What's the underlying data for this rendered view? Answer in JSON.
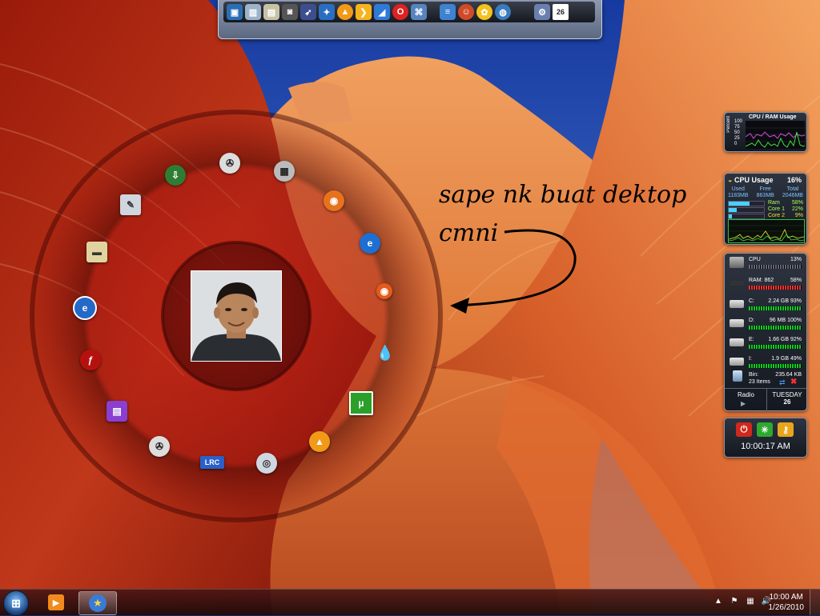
{
  "dock": {
    "icons": [
      "desktop-icon",
      "recycle-bin-icon",
      "folder-icon",
      "camera-icon",
      "rocket-icon",
      "winamp-icon",
      "aimp-icon",
      "logo-icon",
      "opera-icon",
      "app-icon",
      "notepad-icon",
      "smiley-icon",
      "messenger-icon",
      "globe-icon",
      "gear-icon"
    ],
    "calendar_day": "26"
  },
  "annotation": {
    "line1": "sape nk buat dektop",
    "line2": "cmni"
  },
  "cpu_ram_graph": {
    "title": "CPU / RAM Usage",
    "y_label": "Percent",
    "ticks": [
      "100",
      "75",
      "50",
      "25",
      "0"
    ]
  },
  "cpu_usage_gadget": {
    "title": "CPU Usage",
    "percent": "16%",
    "columns": [
      {
        "label": "Used",
        "value": "1183MB"
      },
      {
        "label": "Free",
        "value": "863MB"
      },
      {
        "label": "Total",
        "value": "2046MB"
      }
    ],
    "rows": [
      {
        "label": "Ram",
        "value": "58%",
        "fill": 0.58
      },
      {
        "label": "Core 1",
        "value": "22%",
        "fill": 0.22
      },
      {
        "label": "Core 2",
        "value": "9%",
        "fill": 0.09
      }
    ]
  },
  "system_gadget": {
    "rows": [
      {
        "label": "CPU",
        "value": "13%",
        "bar": "gray"
      },
      {
        "label": "RAM: 862",
        "value": "58%",
        "bar": "red"
      },
      {
        "label": "C:",
        "value": "2.24 GB 93%",
        "bar": "green"
      },
      {
        "label": "D:",
        "value": "96 MB 100%",
        "bar": "green"
      },
      {
        "label": "E:",
        "value": "1.66 GB 92%",
        "bar": "green"
      },
      {
        "label": "I:",
        "value": "1.9 GB 49%",
        "bar": "green"
      }
    ],
    "bin_label": "Bin:",
    "bin_value": "235.64 KB",
    "bin_items": "23 Items",
    "radio_label": "Radio",
    "day": "TUESDAY",
    "date": "26"
  },
  "power_gadget": {
    "clock": "10:00:17 AM"
  },
  "taskbar": {
    "time": "10:00 AM",
    "date": "1/26/2010"
  },
  "ring_icons": [
    "idm-icon",
    "film-reel-icon",
    "film-icon",
    "firefox-icon",
    "ie-icon",
    "firefox-small-icon",
    "drop-icon",
    "utorrent-icon",
    "aimp-icon",
    "cd-icon",
    "lrc-icon",
    "film-reel-icon",
    "winrar-icon",
    "flash-icon",
    "ie-blue-icon",
    "scanner-icon",
    "notepad-icon"
  ],
  "lrc_label": "LRC",
  "utorrent_label": "µ"
}
